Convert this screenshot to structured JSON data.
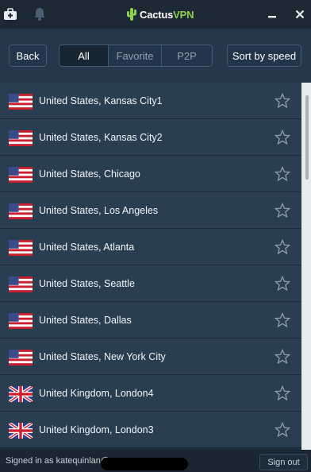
{
  "app": {
    "logo_text_main": "Cactus",
    "logo_text_accent": "VPN"
  },
  "titlebar": {
    "left_icons": [
      "toolbox-icon",
      "bell-icon"
    ],
    "window_buttons": [
      "minimize-icon",
      "close-icon"
    ]
  },
  "toolbar": {
    "back_label": "Back",
    "filter_tabs": [
      {
        "label": "All",
        "active": true
      },
      {
        "label": "Favorite",
        "active": false
      },
      {
        "label": "P2P",
        "active": false
      }
    ],
    "sort_label": "Sort by speed"
  },
  "servers": [
    {
      "flag": "us",
      "name": "United States, Kansas City1",
      "favorite": false
    },
    {
      "flag": "us",
      "name": "United States, Kansas City2",
      "favorite": false
    },
    {
      "flag": "us",
      "name": "United States, Chicago",
      "favorite": false
    },
    {
      "flag": "us",
      "name": "United States, Los Angeles",
      "favorite": false
    },
    {
      "flag": "us",
      "name": "United States, Atlanta",
      "favorite": false
    },
    {
      "flag": "us",
      "name": "United States, Seattle",
      "favorite": false
    },
    {
      "flag": "us",
      "name": "United States, Dallas",
      "favorite": false
    },
    {
      "flag": "us",
      "name": "United States, New York City",
      "favorite": false
    },
    {
      "flag": "uk",
      "name": "United Kingdom, London4",
      "favorite": false
    },
    {
      "flag": "uk",
      "name": "United Kingdom, London3",
      "favorite": false
    }
  ],
  "status": {
    "signed_in_text": "Signed in as katequinlan@",
    "sign_out_label": "Sign out"
  },
  "colors": {
    "accent_green": "#8fd14f",
    "row_bg": "#2a3e52",
    "toolbar_bg": "#25374a"
  }
}
